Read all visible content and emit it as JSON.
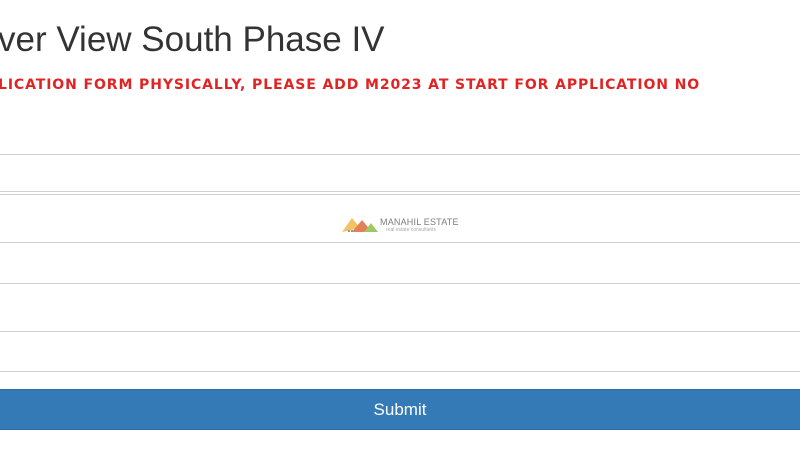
{
  "header": {
    "title": "ver View South Phase IV",
    "notice": "LICATION FORM PHYSICALLY, PLEASE ADD M2023 AT START FOR APPLICATION NO"
  },
  "form": {
    "fields": [
      {
        "value": "",
        "placeholder": ""
      },
      {
        "value": "",
        "placeholder": ""
      },
      {
        "value": "",
        "placeholder": ""
      },
      {
        "value": "",
        "placeholder": ""
      },
      {
        "value": "",
        "placeholder": ""
      }
    ],
    "submit_label": "Submit"
  },
  "watermark": {
    "name": "MANAHIL ESTATE",
    "tagline": "real estate consultants",
    "icon": "mountain-logo-icon"
  },
  "colors": {
    "notice": "#e02424",
    "button": "#337ab7",
    "border": "#d0d0d0",
    "title": "#333333"
  }
}
